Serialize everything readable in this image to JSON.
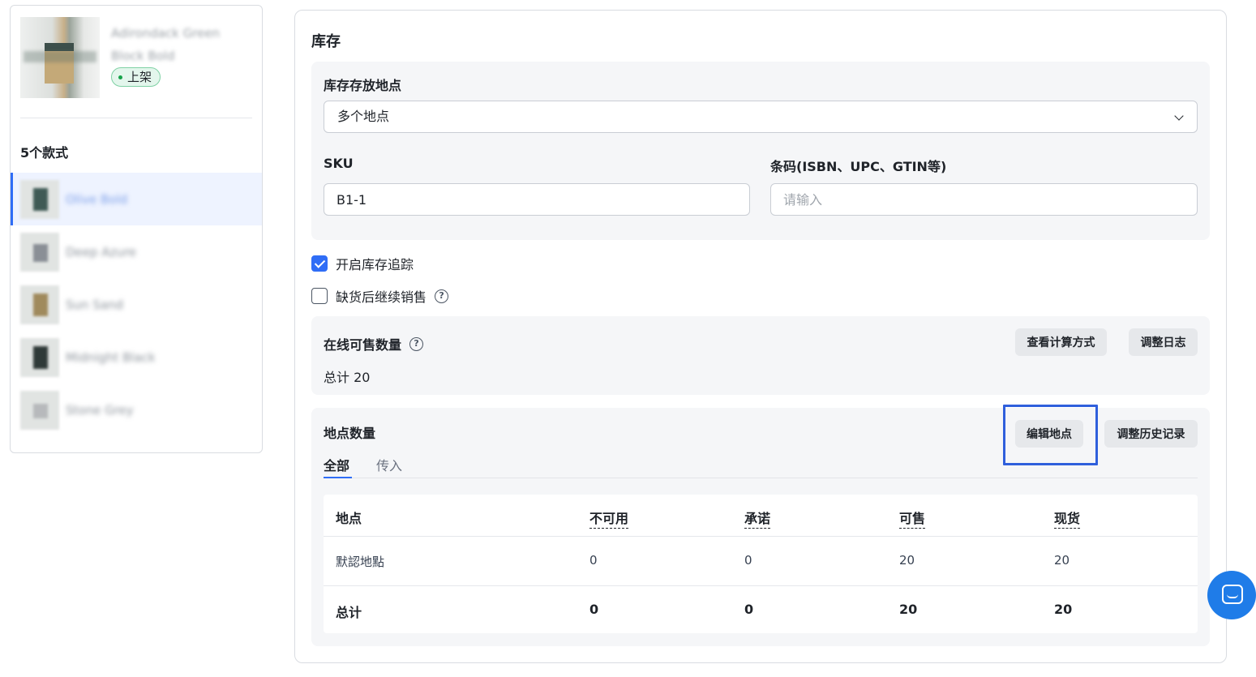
{
  "product": {
    "name": "Adirondack Green Block Bold",
    "status": "上架"
  },
  "variants": {
    "title": "5个款式",
    "items": [
      {
        "label": "Olive Bold"
      },
      {
        "label": "Deep Azure"
      },
      {
        "label": "Sun Sand"
      },
      {
        "label": "Midnight Black"
      },
      {
        "label": "Stone Grey"
      }
    ]
  },
  "inventory": {
    "title": "库存",
    "location_label": "库存存放地点",
    "location_value": "多个地点",
    "sku_label": "SKU",
    "sku_value": "B1-1",
    "barcode_label": "条码(ISBN、UPC、GTIN等)",
    "barcode_placeholder": "请输入",
    "track_label": "开启库存追踪",
    "track_checked": true,
    "continue_label": "缺货后继续销售",
    "continue_checked": false
  },
  "online": {
    "title": "在线可售数量",
    "total": "总计 20",
    "view_calc_button": "查看计算方式",
    "adjust_log_button": "调整日志"
  },
  "locations": {
    "title": "地点数量",
    "edit_button": "编辑地点",
    "history_button": "调整历史记录",
    "tabs": [
      "全部",
      "传入"
    ],
    "columns": [
      "地点",
      "不可用",
      "承诺",
      "可售",
      "现货"
    ],
    "rows": [
      {
        "location": "默認地點",
        "unavailable": "0",
        "committed": "0",
        "available": "20",
        "on_hand": "20"
      }
    ],
    "total_row": {
      "label": "总计",
      "unavailable": "0",
      "committed": "0",
      "available": "20",
      "on_hand": "20"
    }
  },
  "colors": {
    "accent": "#2f6df6",
    "status_green": "#16a34a",
    "chat_button": "#1f7ce8"
  },
  "icons": [
    "chevron-down-icon",
    "check-icon",
    "help-circle-icon",
    "chat-icon"
  ]
}
